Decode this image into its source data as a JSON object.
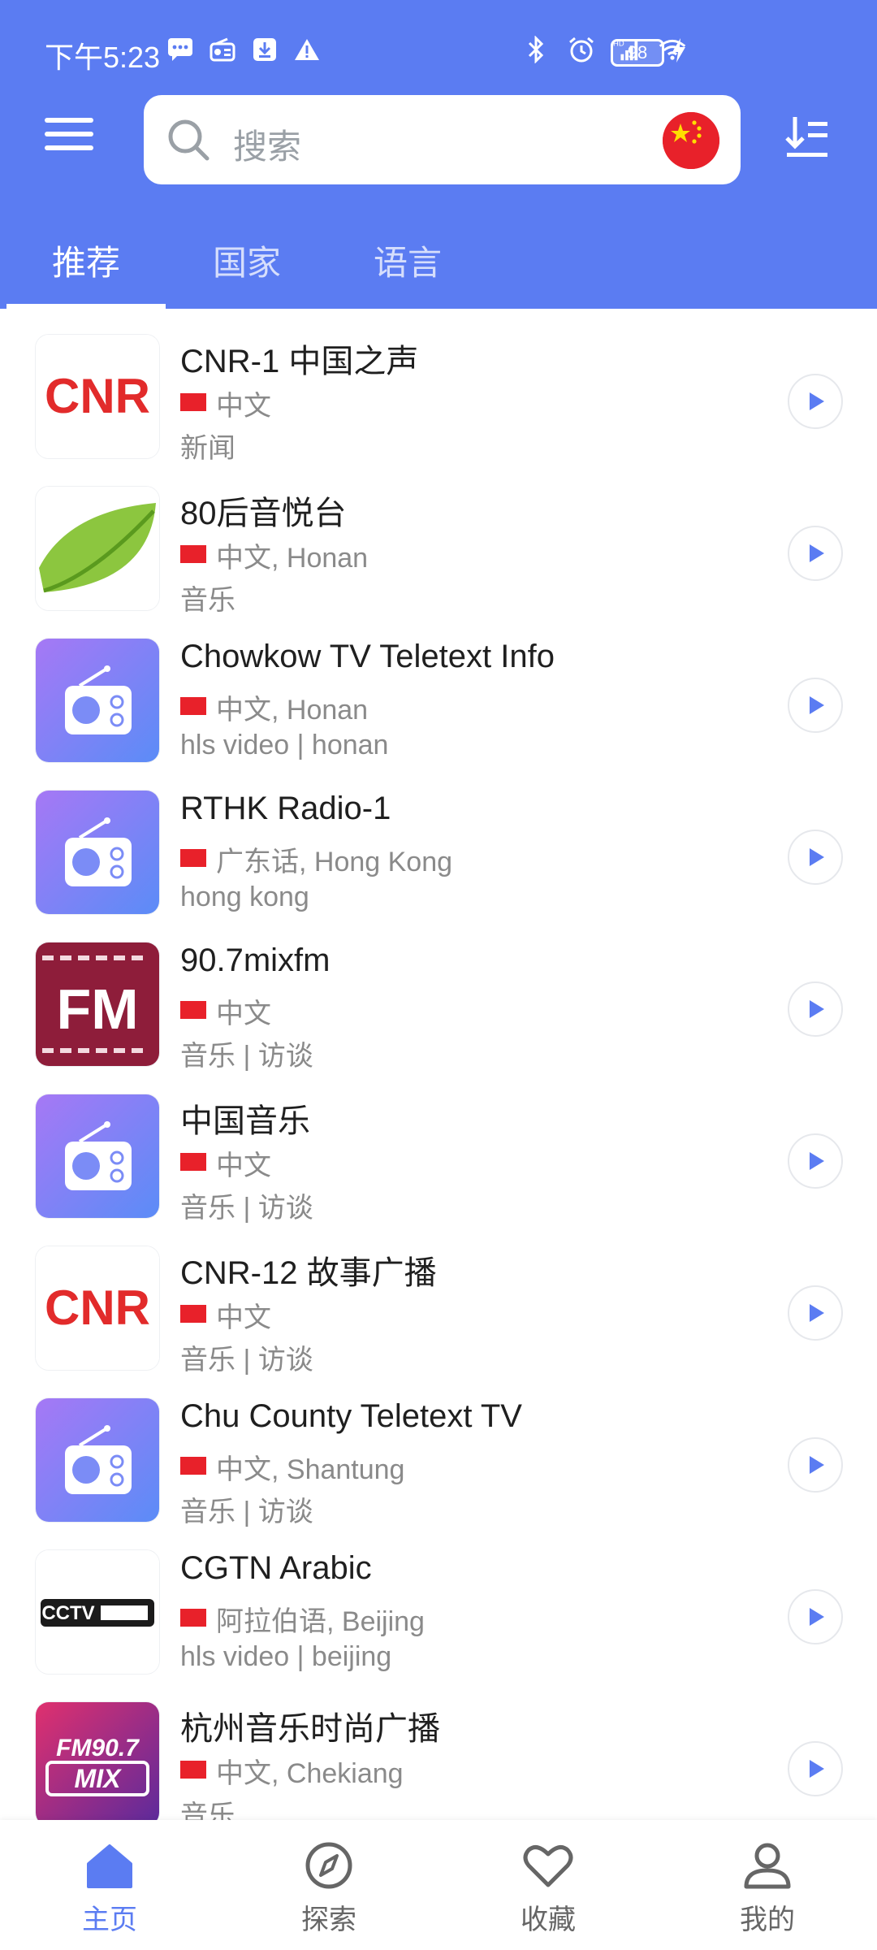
{
  "status_bar": {
    "time": "下午5:23",
    "battery": "98"
  },
  "search": {
    "placeholder": "搜索"
  },
  "tabs": [
    {
      "label": "推荐",
      "active": true
    },
    {
      "label": "国家",
      "active": false
    },
    {
      "label": "语言",
      "active": false
    }
  ],
  "stations": [
    {
      "title": "CNR-1 中国之声",
      "lang": "中文",
      "tags": "新闻",
      "logo": "CNR"
    },
    {
      "title": "80后音悦台",
      "lang": "中文, Honan",
      "tags": "音乐",
      "logo": "leaf"
    },
    {
      "title": "Chowkow TV Teletext Info",
      "lang": "中文, Honan",
      "tags": "hls video | honan",
      "logo": "radio"
    },
    {
      "title": "RTHK Radio-1",
      "lang": "广东话, Hong Kong",
      "tags": "hong kong",
      "logo": "radio"
    },
    {
      "title": "90.7mixfm",
      "lang": "中文",
      "tags": "音乐 | 访谈",
      "logo": "FM"
    },
    {
      "title": "中国音乐",
      "lang": "中文",
      "tags": "音乐 | 访谈",
      "logo": "radio"
    },
    {
      "title": "CNR-12 故事广播",
      "lang": "中文",
      "tags": "音乐 | 访谈",
      "logo": "CNR"
    },
    {
      "title": "Chu County Teletext TV",
      "lang": "中文, Shantung",
      "tags": "音乐 | 访谈",
      "logo": "radio"
    },
    {
      "title": "CGTN Arabic",
      "lang": "阿拉伯语, Beijing",
      "tags": "hls video | beijing",
      "logo": "CCTV"
    },
    {
      "title": "杭州音乐时尚广播",
      "lang": "中文, Chekiang",
      "tags": "音乐",
      "logo": "MIX"
    }
  ],
  "logo_texts": {
    "cnr": "CNR",
    "fm": "FM",
    "cctv": "CCTV",
    "mix_top": "FM90.7",
    "mix_bottom": "MIX"
  },
  "bottom_nav": [
    {
      "label": "主页",
      "icon": "home-icon",
      "active": true
    },
    {
      "label": "探索",
      "icon": "compass-icon",
      "active": false
    },
    {
      "label": "收藏",
      "icon": "heart-icon",
      "active": false
    },
    {
      "label": "我的",
      "icon": "user-icon",
      "active": false
    }
  ],
  "colors": {
    "primary": "#5b7cf2",
    "flag_red": "#e8212a",
    "text_secondary": "#8a8a8a"
  }
}
